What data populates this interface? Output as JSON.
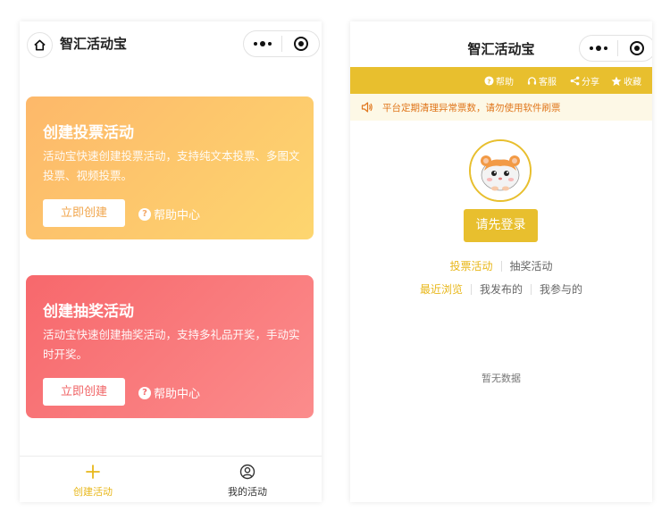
{
  "left_screen": {
    "nav": {
      "title": "智汇活动宝"
    },
    "vote_card": {
      "title": "创建投票活动",
      "description": "活动宝快速创建投票活动，支持纯文本投票、多图文投票、视频投票。",
      "create_label": "立即创建",
      "help_label": "帮助中心"
    },
    "lottery_card": {
      "title": "创建抽奖活动",
      "description": "活动宝快速创建抽奖活动，支持多礼品开奖，手动实时开奖。",
      "create_label": "立即创建",
      "help_label": "帮助中心"
    },
    "tabbar": {
      "create_label": "创建活动",
      "mine_label": "我的活动"
    }
  },
  "right_screen": {
    "nav": {
      "title": "智汇活动宝"
    },
    "toolbar": {
      "help": "帮助",
      "service": "客服",
      "share": "分享",
      "favorite": "收藏"
    },
    "notice": "平台定期清理异常票数，请勿使用软件刷票",
    "login_label": "请先登录",
    "type_tabs": [
      "投票活动",
      "抽奖活动"
    ],
    "filter_tabs": [
      "最近浏览",
      "我发布的",
      "我参与的"
    ],
    "empty_text": "暂无数据"
  },
  "colors": {
    "accent_yellow": "#e8bf2e",
    "vote_gradient": [
      "#fdb86a",
      "#fdd66f"
    ],
    "lottery_gradient": [
      "#f7686c",
      "#fb8c8c"
    ],
    "notice_text": "#e0761c"
  },
  "icons": [
    "home-icon",
    "more-icon",
    "close-icon",
    "plus-icon",
    "user-icon",
    "question-icon",
    "headset-icon",
    "share-icon",
    "star-icon",
    "speaker-icon",
    "hamster-avatar"
  ]
}
